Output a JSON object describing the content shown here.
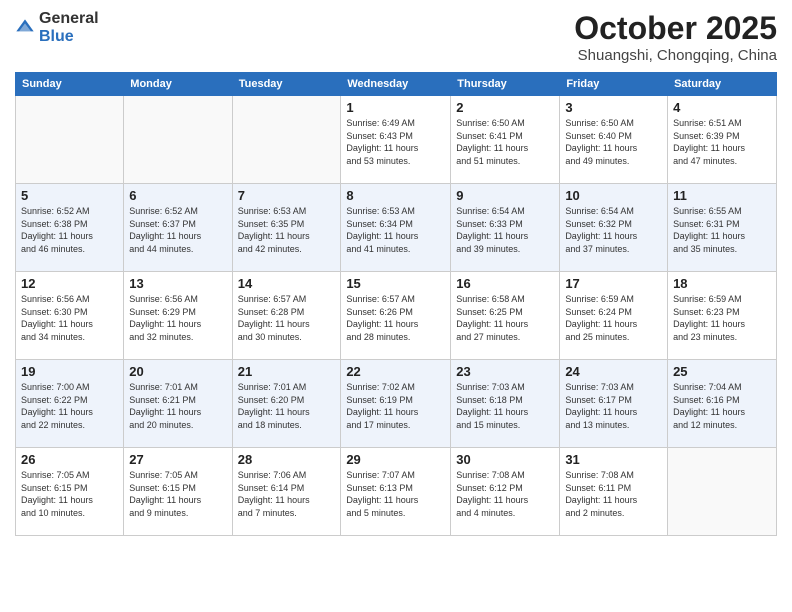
{
  "logo": {
    "general": "General",
    "blue": "Blue"
  },
  "title": "October 2025",
  "subtitle": "Shuangshi, Chongqing, China",
  "headers": [
    "Sunday",
    "Monday",
    "Tuesday",
    "Wednesday",
    "Thursday",
    "Friday",
    "Saturday"
  ],
  "weeks": [
    [
      {
        "day": "",
        "info": ""
      },
      {
        "day": "",
        "info": ""
      },
      {
        "day": "",
        "info": ""
      },
      {
        "day": "1",
        "info": "Sunrise: 6:49 AM\nSunset: 6:43 PM\nDaylight: 11 hours\nand 53 minutes."
      },
      {
        "day": "2",
        "info": "Sunrise: 6:50 AM\nSunset: 6:41 PM\nDaylight: 11 hours\nand 51 minutes."
      },
      {
        "day": "3",
        "info": "Sunrise: 6:50 AM\nSunset: 6:40 PM\nDaylight: 11 hours\nand 49 minutes."
      },
      {
        "day": "4",
        "info": "Sunrise: 6:51 AM\nSunset: 6:39 PM\nDaylight: 11 hours\nand 47 minutes."
      }
    ],
    [
      {
        "day": "5",
        "info": "Sunrise: 6:52 AM\nSunset: 6:38 PM\nDaylight: 11 hours\nand 46 minutes."
      },
      {
        "day": "6",
        "info": "Sunrise: 6:52 AM\nSunset: 6:37 PM\nDaylight: 11 hours\nand 44 minutes."
      },
      {
        "day": "7",
        "info": "Sunrise: 6:53 AM\nSunset: 6:35 PM\nDaylight: 11 hours\nand 42 minutes."
      },
      {
        "day": "8",
        "info": "Sunrise: 6:53 AM\nSunset: 6:34 PM\nDaylight: 11 hours\nand 41 minutes."
      },
      {
        "day": "9",
        "info": "Sunrise: 6:54 AM\nSunset: 6:33 PM\nDaylight: 11 hours\nand 39 minutes."
      },
      {
        "day": "10",
        "info": "Sunrise: 6:54 AM\nSunset: 6:32 PM\nDaylight: 11 hours\nand 37 minutes."
      },
      {
        "day": "11",
        "info": "Sunrise: 6:55 AM\nSunset: 6:31 PM\nDaylight: 11 hours\nand 35 minutes."
      }
    ],
    [
      {
        "day": "12",
        "info": "Sunrise: 6:56 AM\nSunset: 6:30 PM\nDaylight: 11 hours\nand 34 minutes."
      },
      {
        "day": "13",
        "info": "Sunrise: 6:56 AM\nSunset: 6:29 PM\nDaylight: 11 hours\nand 32 minutes."
      },
      {
        "day": "14",
        "info": "Sunrise: 6:57 AM\nSunset: 6:28 PM\nDaylight: 11 hours\nand 30 minutes."
      },
      {
        "day": "15",
        "info": "Sunrise: 6:57 AM\nSunset: 6:26 PM\nDaylight: 11 hours\nand 28 minutes."
      },
      {
        "day": "16",
        "info": "Sunrise: 6:58 AM\nSunset: 6:25 PM\nDaylight: 11 hours\nand 27 minutes."
      },
      {
        "day": "17",
        "info": "Sunrise: 6:59 AM\nSunset: 6:24 PM\nDaylight: 11 hours\nand 25 minutes."
      },
      {
        "day": "18",
        "info": "Sunrise: 6:59 AM\nSunset: 6:23 PM\nDaylight: 11 hours\nand 23 minutes."
      }
    ],
    [
      {
        "day": "19",
        "info": "Sunrise: 7:00 AM\nSunset: 6:22 PM\nDaylight: 11 hours\nand 22 minutes."
      },
      {
        "day": "20",
        "info": "Sunrise: 7:01 AM\nSunset: 6:21 PM\nDaylight: 11 hours\nand 20 minutes."
      },
      {
        "day": "21",
        "info": "Sunrise: 7:01 AM\nSunset: 6:20 PM\nDaylight: 11 hours\nand 18 minutes."
      },
      {
        "day": "22",
        "info": "Sunrise: 7:02 AM\nSunset: 6:19 PM\nDaylight: 11 hours\nand 17 minutes."
      },
      {
        "day": "23",
        "info": "Sunrise: 7:03 AM\nSunset: 6:18 PM\nDaylight: 11 hours\nand 15 minutes."
      },
      {
        "day": "24",
        "info": "Sunrise: 7:03 AM\nSunset: 6:17 PM\nDaylight: 11 hours\nand 13 minutes."
      },
      {
        "day": "25",
        "info": "Sunrise: 7:04 AM\nSunset: 6:16 PM\nDaylight: 11 hours\nand 12 minutes."
      }
    ],
    [
      {
        "day": "26",
        "info": "Sunrise: 7:05 AM\nSunset: 6:15 PM\nDaylight: 11 hours\nand 10 minutes."
      },
      {
        "day": "27",
        "info": "Sunrise: 7:05 AM\nSunset: 6:15 PM\nDaylight: 11 hours\nand 9 minutes."
      },
      {
        "day": "28",
        "info": "Sunrise: 7:06 AM\nSunset: 6:14 PM\nDaylight: 11 hours\nand 7 minutes."
      },
      {
        "day": "29",
        "info": "Sunrise: 7:07 AM\nSunset: 6:13 PM\nDaylight: 11 hours\nand 5 minutes."
      },
      {
        "day": "30",
        "info": "Sunrise: 7:08 AM\nSunset: 6:12 PM\nDaylight: 11 hours\nand 4 minutes."
      },
      {
        "day": "31",
        "info": "Sunrise: 7:08 AM\nSunset: 6:11 PM\nDaylight: 11 hours\nand 2 minutes."
      },
      {
        "day": "",
        "info": ""
      }
    ]
  ]
}
